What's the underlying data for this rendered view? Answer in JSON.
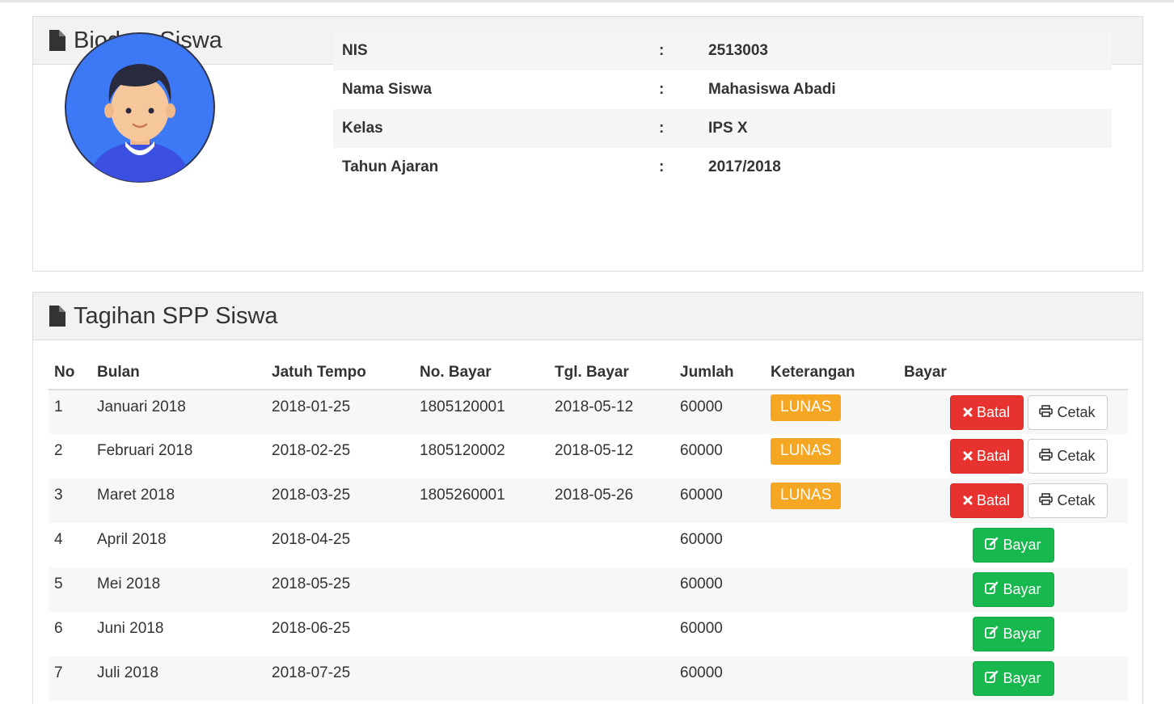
{
  "biodata": {
    "title": "Biodata Siswa",
    "rows": [
      {
        "label": "NIS",
        "sep": ":",
        "value": "2513003"
      },
      {
        "label": "Nama Siswa",
        "sep": ":",
        "value": "Mahasiswa Abadi"
      },
      {
        "label": "Kelas",
        "sep": ":",
        "value": "IPS X"
      },
      {
        "label": "Tahun Ajaran",
        "sep": ":",
        "value": "2017/2018"
      }
    ]
  },
  "tagihan": {
    "title": "Tagihan SPP Siswa",
    "headers": [
      "No",
      "Bulan",
      "Jatuh Tempo",
      "No. Bayar",
      "Tgl. Bayar",
      "Jumlah",
      "Keterangan",
      "Bayar"
    ],
    "rows": [
      {
        "no": "1",
        "bulan": "Januari 2018",
        "tempo": "2018-01-25",
        "nobayar": "1805120001",
        "tgl": "2018-05-12",
        "jumlah": "60000",
        "ket": "LUNAS",
        "paid": true
      },
      {
        "no": "2",
        "bulan": "Februari 2018",
        "tempo": "2018-02-25",
        "nobayar": "1805120002",
        "tgl": "2018-05-12",
        "jumlah": "60000",
        "ket": "LUNAS",
        "paid": true
      },
      {
        "no": "3",
        "bulan": "Maret 2018",
        "tempo": "2018-03-25",
        "nobayar": "1805260001",
        "tgl": "2018-05-26",
        "jumlah": "60000",
        "ket": "LUNAS",
        "paid": true
      },
      {
        "no": "4",
        "bulan": "April 2018",
        "tempo": "2018-04-25",
        "nobayar": "",
        "tgl": "",
        "jumlah": "60000",
        "ket": "",
        "paid": false
      },
      {
        "no": "5",
        "bulan": "Mei 2018",
        "tempo": "2018-05-25",
        "nobayar": "",
        "tgl": "",
        "jumlah": "60000",
        "ket": "",
        "paid": false
      },
      {
        "no": "6",
        "bulan": "Juni 2018",
        "tempo": "2018-06-25",
        "nobayar": "",
        "tgl": "",
        "jumlah": "60000",
        "ket": "",
        "paid": false
      },
      {
        "no": "7",
        "bulan": "Juli 2018",
        "tempo": "2018-07-25",
        "nobayar": "",
        "tgl": "",
        "jumlah": "60000",
        "ket": "",
        "paid": false
      }
    ],
    "buttons": {
      "batal": "Batal",
      "cetak": "Cetak",
      "bayar": "Bayar"
    }
  },
  "colors": {
    "badge_lunas": "#f5a623",
    "btn_danger": "#e8322f",
    "btn_success": "#17b84d",
    "avatar_bg": "#3d78f5"
  },
  "icons": {
    "panel": "file-icon",
    "batal": "times-icon",
    "cetak": "print-icon",
    "bayar": "edit-icon"
  }
}
